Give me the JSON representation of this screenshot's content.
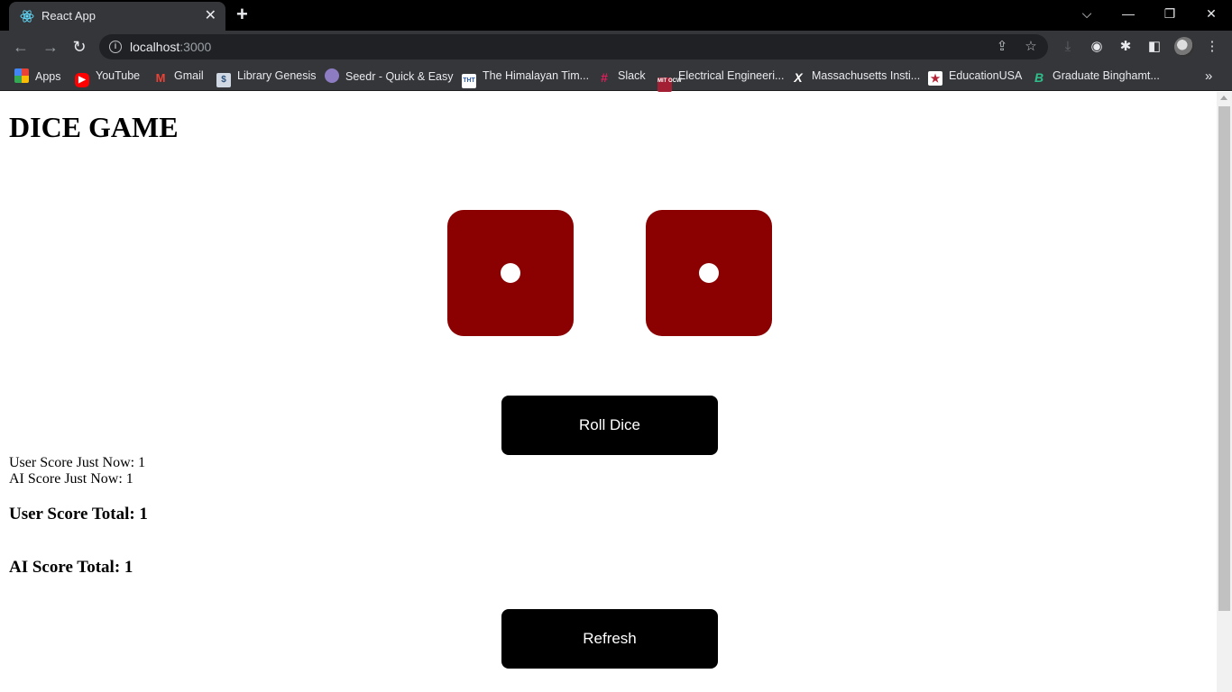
{
  "browser": {
    "tab_title": "React App",
    "url_host": "localhost",
    "url_port": ":3000",
    "bookmarks": [
      {
        "label": "Apps",
        "icon": "apps-grid-icon",
        "color": "#ea4335"
      },
      {
        "label": "YouTube",
        "icon": "youtube-icon",
        "color": "#ff0000"
      },
      {
        "label": "Gmail",
        "icon": "gmail-icon",
        "color": "#ea4335"
      },
      {
        "label": "Library Genesis",
        "icon": "library-genesis-icon",
        "color": "#5b7fa6"
      },
      {
        "label": "Seedr - Quick & Easy",
        "icon": "seedr-icon",
        "color": "#8e7cc3"
      },
      {
        "label": "The Himalayan Tim...",
        "icon": "himalayan-times-icon",
        "color": "#2a5aa8"
      },
      {
        "label": "Slack",
        "icon": "slack-icon",
        "color": "#e01e5a"
      },
      {
        "label": "Electrical Engineeri...",
        "icon": "mit-ocw-icon",
        "color": "#a31f34"
      },
      {
        "label": "Massachusetts Insti...",
        "icon": "edx-icon",
        "color": "#ffffff"
      },
      {
        "label": "EducationUSA",
        "icon": "educationusa-icon",
        "color": "#b22234"
      },
      {
        "label": "Graduate Binghamt...",
        "icon": "binghamton-icon",
        "color": "#005a43"
      }
    ]
  },
  "page": {
    "title": "DICE GAME",
    "dice": [
      {
        "value": 1,
        "color": "#8b0000"
      },
      {
        "value": 1,
        "color": "#8b0000"
      }
    ],
    "roll_button_label": "Roll Dice",
    "user_score_now": "User Score Just Now: 1",
    "ai_score_now": "AI Score Just Now: 1",
    "user_score_total": "User Score Total: 1",
    "ai_score_total": "AI Score Total: 1",
    "refresh_button_label": "Refresh"
  }
}
